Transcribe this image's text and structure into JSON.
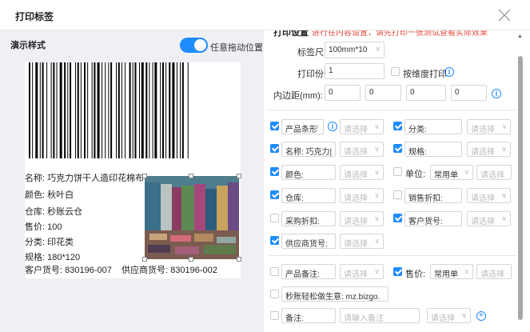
{
  "header": {
    "title": "打印标签",
    "close_icon": "close-icon"
  },
  "preview": {
    "label": "演示样式",
    "drag_toggle_label": "任意拖动位置",
    "drag_toggle_on": true,
    "fields": {
      "name": "名称: 巧克力饼干人造印花棉布",
      "color": "颜色: 秋叶白",
      "warehouse": "仓库: 秒账云仓",
      "price": "售价: 100",
      "category": "分类: 印花类",
      "spec": "规格: 180*120",
      "customer_sku": "客户货号: 830196-007",
      "supplier_sku": "供应商货号: 830196-002"
    },
    "photo_icon": "fabric-photo-icon"
  },
  "settings": {
    "section_title": "打印设置",
    "section_note": "进行在内容设置，请先打印一张测试查看实际效果",
    "size_label": "标签尺寸:",
    "size_value": "100mm*10",
    "copies_label": "打印份数:",
    "copies_value": "1",
    "by_dimension_label": "按维度打印",
    "padding_label": "内边距(mm):",
    "padding_values": [
      "0",
      "0",
      "0",
      "0"
    ],
    "placeholder_select": "请选择",
    "placeholder_input": "请输入备注",
    "rows": {
      "barcode_type": "产品条形",
      "category": "分类:",
      "name": "名称: 巧克力|",
      "spec": "规格:",
      "color": "颜色:",
      "unit": "单位:",
      "unit_value": "常用单",
      "warehouse": "仓库:",
      "sales_discount": "销售折扣:",
      "purchase_discount": "采购折扣:",
      "customer_sku": "客户货号:",
      "supplier_sku": "供应商货号:",
      "product_note": "产品备注:",
      "price": "售价:",
      "price_value": "常用单",
      "shop_link": "秒账轻松做生意: mz.bizgo.",
      "remark": "备注:"
    }
  },
  "colors": {
    "accent": "#1e8cff",
    "warning": "#e54b3c"
  }
}
